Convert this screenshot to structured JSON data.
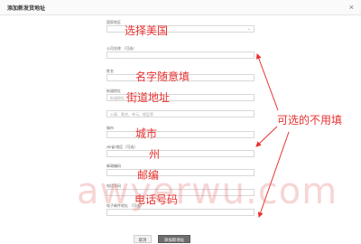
{
  "dialog": {
    "title": "添加新发货地址",
    "close_glyph": "×"
  },
  "form": {
    "fields": [
      {
        "label": "国家地区",
        "value": "",
        "has_dropdown": true
      },
      {
        "label": "公司名称 （可选）",
        "value": ""
      },
      {
        "label": "姓名",
        "value": ""
      },
      {
        "label": "街道地址",
        "value": "",
        "placeholder": "街道地址",
        "placeholder2": "公寓、套房、单元、楼层等"
      },
      {
        "label": "城市",
        "value": ""
      },
      {
        "label": "州/省/地区（可选）",
        "value": ""
      },
      {
        "label": "邮政编码",
        "value": ""
      },
      {
        "label": "电话号码",
        "value": ""
      },
      {
        "label": "电子邮件地址 （可选）",
        "value": ""
      }
    ],
    "cancel_label": "取消",
    "save_label": "添加新地址"
  },
  "annotations": {
    "select_us": "选择美国",
    "name": "名字随意填",
    "street": "街道地址",
    "city": "城市",
    "state": "州",
    "zip": "邮编",
    "phone": "电话号码",
    "optional": "可选的不用填"
  },
  "watermark": "awyerwu.com",
  "colors": {
    "annotation": "#e8312f",
    "arrow": "#e8312f"
  }
}
